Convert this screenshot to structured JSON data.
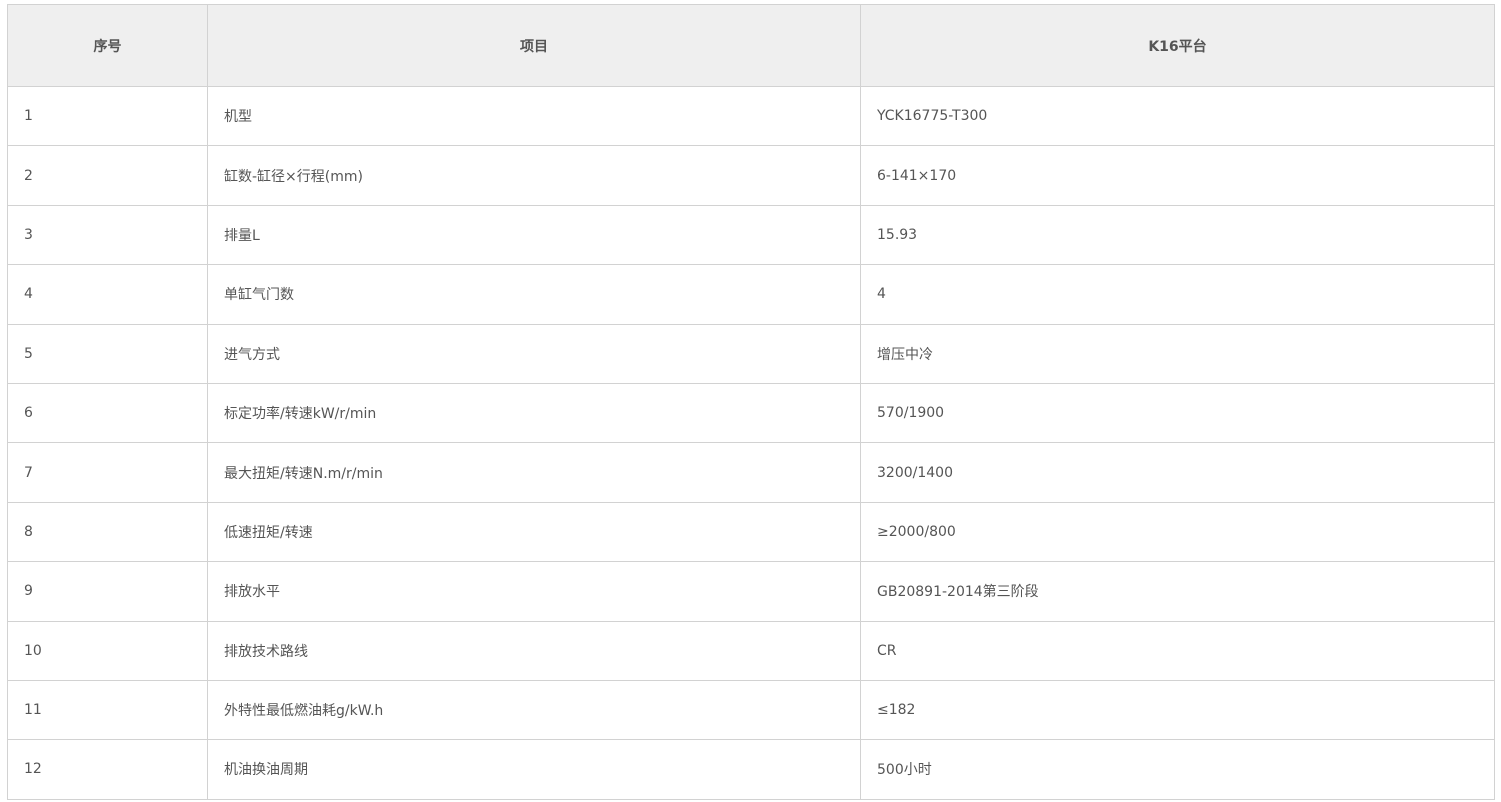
{
  "table": {
    "headers": [
      "序号",
      "项目",
      "K16平台"
    ],
    "rows": [
      [
        "1",
        "机型",
        "YCK16775-T300"
      ],
      [
        "2",
        "缸数-缸径×行程(mm)",
        "6-141×170"
      ],
      [
        "3",
        "排量L",
        "15.93"
      ],
      [
        "4",
        "单缸气门数",
        "4"
      ],
      [
        "5",
        "进气方式",
        "增压中冷"
      ],
      [
        "6",
        "标定功率/转速kW/r/min",
        "570/1900"
      ],
      [
        "7",
        "最大扭矩/转速N.m/r/min",
        "3200/1400"
      ],
      [
        "8",
        "低速扭矩/转速",
        "≥2000/800"
      ],
      [
        "9",
        "排放水平",
        "GB20891-2014第三阶段"
      ],
      [
        "10",
        "排放技术路线",
        "CR"
      ],
      [
        "11",
        "外特性最低燃油耗g/kW.h",
        "≤182"
      ],
      [
        "12",
        "机油换油周期",
        "500小时"
      ]
    ]
  }
}
